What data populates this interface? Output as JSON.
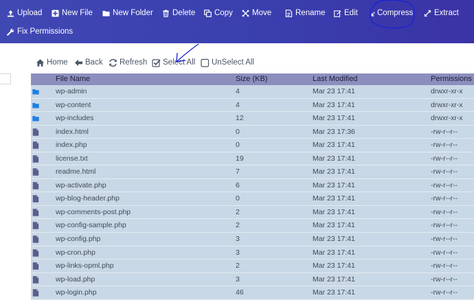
{
  "toolbar": {
    "row1": [
      {
        "id": "upload",
        "label": "Upload",
        "icon": "upload-icon"
      },
      {
        "id": "new-file",
        "label": "New File",
        "icon": "plus-square-icon"
      },
      {
        "id": "new-folder",
        "label": "New Folder",
        "icon": "folder-plus-icon"
      },
      {
        "id": "delete",
        "label": "Delete",
        "icon": "trash-icon"
      },
      {
        "id": "copy",
        "label": "Copy",
        "icon": "copy-icon"
      },
      {
        "id": "move",
        "label": "Move",
        "icon": "move-arrows-icon"
      },
      {
        "id": "rename",
        "label": "Rename",
        "icon": "file-text-icon"
      },
      {
        "id": "edit",
        "label": "Edit",
        "icon": "edit-icon"
      },
      {
        "id": "compress",
        "label": "Compress",
        "icon": "compress-icon"
      },
      {
        "id": "extract",
        "label": "Extract",
        "icon": "expand-icon"
      }
    ],
    "row2": [
      {
        "id": "fix-permissions",
        "label": "Fix Permissions",
        "icon": "wrench-icon"
      }
    ]
  },
  "nav": [
    {
      "id": "home",
      "label": "Home",
      "icon": "home-icon"
    },
    {
      "id": "back",
      "label": "Back",
      "icon": "arrow-left-icon"
    },
    {
      "id": "refresh",
      "label": "Refresh",
      "icon": "refresh-icon"
    },
    {
      "id": "select-all",
      "label": "Select All",
      "icon": "checkbox-checked-icon"
    },
    {
      "id": "unselect-all",
      "label": "UnSelect All",
      "icon": "checkbox-empty-icon"
    }
  ],
  "table": {
    "columns": [
      "File Name",
      "Size (KB)",
      "Last Modified",
      "Permissions"
    ],
    "rows": [
      {
        "type": "folder",
        "name": "wp-admin",
        "size": "4",
        "modified": "Mar 23 17:41",
        "perms": "drwxr-xr-x"
      },
      {
        "type": "folder",
        "name": "wp-content",
        "size": "4",
        "modified": "Mar 23 17:41",
        "perms": "drwxr-xr-x"
      },
      {
        "type": "folder",
        "name": "wp-includes",
        "size": "12",
        "modified": "Mar 23 17:41",
        "perms": "drwxr-xr-x"
      },
      {
        "type": "file",
        "name": "index.html",
        "size": "0",
        "modified": "Mar 23 17:36",
        "perms": "-rw-r--r--"
      },
      {
        "type": "file",
        "name": "index.php",
        "size": "0",
        "modified": "Mar 23 17:41",
        "perms": "-rw-r--r--"
      },
      {
        "type": "file",
        "name": "license.txt",
        "size": "19",
        "modified": "Mar 23 17:41",
        "perms": "-rw-r--r--"
      },
      {
        "type": "file",
        "name": "readme.html",
        "size": "7",
        "modified": "Mar 23 17:41",
        "perms": "-rw-r--r--"
      },
      {
        "type": "file",
        "name": "wp-activate.php",
        "size": "6",
        "modified": "Mar 23 17:41",
        "perms": "-rw-r--r--"
      },
      {
        "type": "file",
        "name": "wp-blog-header.php",
        "size": "0",
        "modified": "Mar 23 17:41",
        "perms": "-rw-r--r--"
      },
      {
        "type": "file",
        "name": "wp-comments-post.php",
        "size": "2",
        "modified": "Mar 23 17:41",
        "perms": "-rw-r--r--"
      },
      {
        "type": "file",
        "name": "wp-config-sample.php",
        "size": "2",
        "modified": "Mar 23 17:41",
        "perms": "-rw-r--r--"
      },
      {
        "type": "file",
        "name": "wp-config.php",
        "size": "3",
        "modified": "Mar 23 17:41",
        "perms": "-rw-r--r--"
      },
      {
        "type": "file",
        "name": "wp-cron.php",
        "size": "3",
        "modified": "Mar 23 17:41",
        "perms": "-rw-r--r--"
      },
      {
        "type": "file",
        "name": "wp-links-opml.php",
        "size": "2",
        "modified": "Mar 23 17:41",
        "perms": "-rw-r--r--"
      },
      {
        "type": "file",
        "name": "wp-load.php",
        "size": "3",
        "modified": "Mar 23 17:41",
        "perms": "-rw-r--r--"
      },
      {
        "type": "file",
        "name": "wp-login.php",
        "size": "46",
        "modified": "Mar 23 17:41",
        "perms": "-rw-r--r--"
      }
    ]
  },
  "colors": {
    "toolbar": "#3a3fae",
    "header": "#8c8fbd",
    "row": "#c9d8e6",
    "folder": "#1e7fe6",
    "file": "#5b5d8c",
    "annotation": "#1a22d6"
  }
}
